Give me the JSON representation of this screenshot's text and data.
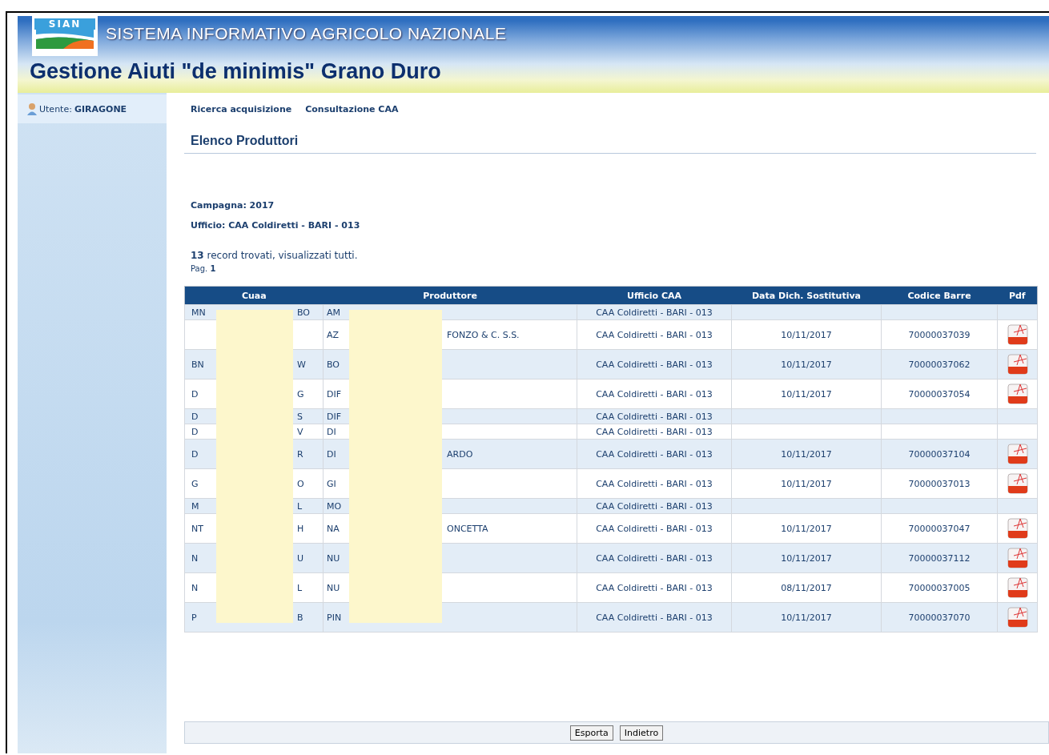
{
  "header": {
    "logo": "SIAN",
    "system_title": "SISTEMA INFORMATIVO AGRICOLO NAZIONALE",
    "app_title": "Gestione Aiuti \"de minimis\" Grano Duro"
  },
  "sidebar": {
    "user_label": "Utente:",
    "user_name": "GIRAGONE"
  },
  "nav": [
    {
      "label": "Ricerca acquisizione"
    },
    {
      "label": "Consultazione CAA"
    }
  ],
  "page_title": "Elenco Produttori",
  "info": [
    "Campagna: 2017",
    "Ufficio: CAA Coldiretti - BARI - 013"
  ],
  "results": "**13** record trovati, visualizzati tutti.",
  "page": "Pag. **1**",
  "table": {
    "columns": [
      "Cuaa",
      "Produttore",
      "Ufficio CAA",
      "Data Dich. Sostitutiva",
      "Codice Barre",
      "Pdf"
    ],
    "rows": [
      {
        "cuaa_start": "MN",
        "cuaa_end": "BO",
        "produttore_start": "AM",
        "ufficio": "CAA Coldiretti - BARI - 013",
        "pdf": false
      },
      {
        "produttore_start": "AZ",
        "produttore_end": "FONZO & C. S.S.",
        "ufficio": "CAA Coldiretti - BARI - 013",
        "data": "10/11/2017",
        "codice": "70000037039",
        "pdf": true
      },
      {
        "cuaa_start": "BN",
        "cuaa_end": "W",
        "produttore_start": "BO",
        "ufficio": "CAA Coldiretti - BARI - 013",
        "data": "10/11/2017",
        "codice": "70000037062",
        "pdf": true
      },
      {
        "cuaa_start": "D",
        "cuaa_end": "G",
        "produttore_start": "DIF",
        "ufficio": "CAA Coldiretti - BARI - 013",
        "data": "10/11/2017",
        "codice": "70000037054",
        "pdf": true
      },
      {
        "cuaa_start": "D",
        "cuaa_end": "S",
        "produttore_start": "DIF",
        "ufficio": "CAA Coldiretti - BARI - 013",
        "pdf": false
      },
      {
        "cuaa_start": "D",
        "cuaa_end": "V",
        "produttore_start": "DI",
        "ufficio": "CAA Coldiretti - BARI - 013",
        "pdf": false
      },
      {
        "cuaa_start": "D",
        "cuaa_end": "R",
        "produttore_start": "DI",
        "produttore_end": "ARDO",
        "ufficio": "CAA Coldiretti - BARI - 013",
        "data": "10/11/2017",
        "codice": "70000037104",
        "pdf": true
      },
      {
        "cuaa_start": "G",
        "cuaa_end": "O",
        "produttore_start": "GI",
        "ufficio": "CAA Coldiretti - BARI - 013",
        "data": "10/11/2017",
        "codice": "70000037013",
        "pdf": true
      },
      {
        "cuaa_start": "M",
        "cuaa_end": "L",
        "produttore_start": "MO",
        "ufficio": "CAA Coldiretti - BARI - 013",
        "pdf": false
      },
      {
        "cuaa_start": "NT",
        "cuaa_end": "H",
        "produttore_start": "NA",
        "produttore_end": "ONCETTA",
        "ufficio": "CAA Coldiretti - BARI - 013",
        "data": "10/11/2017",
        "codice": "70000037047",
        "pdf": true
      },
      {
        "cuaa_start": "N",
        "cuaa_end": "U",
        "produttore_start": "NU",
        "ufficio": "CAA Coldiretti - BARI - 013",
        "data": "10/11/2017",
        "codice": "70000037112",
        "pdf": true
      },
      {
        "cuaa_start": "N",
        "cuaa_end": "L",
        "produttore_start": "NU",
        "ufficio": "CAA Coldiretti - BARI - 013",
        "data": "08/11/2017",
        "codice": "70000037005",
        "pdf": true
      },
      {
        "cuaa_start": "P",
        "cuaa_end": "B",
        "produttore_start": "PIN",
        "ufficio": "CAA Coldiretti - BARI - 013",
        "data": "10/11/2017",
        "codice": "70000037070",
        "pdf": true
      }
    ]
  },
  "buttons": [
    {
      "label": "Esporta"
    },
    {
      "label": "Indietro"
    }
  ]
}
